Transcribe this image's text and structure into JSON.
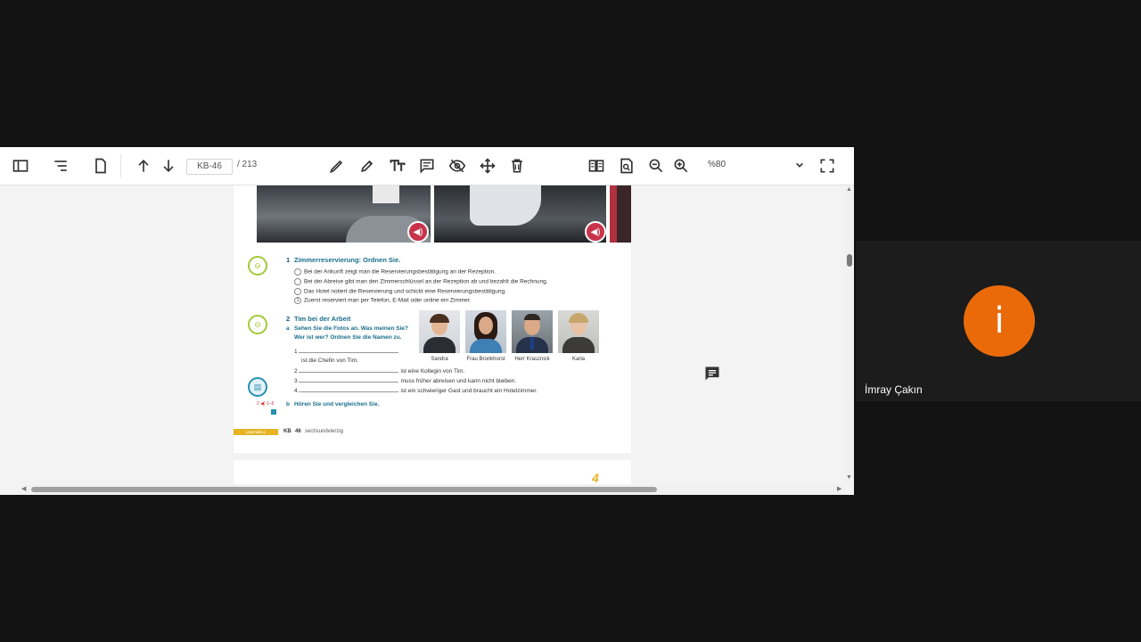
{
  "toolbar": {
    "page_current": "KB-46",
    "page_total": "/ 213",
    "zoom": "%80"
  },
  "document": {
    "ex1": {
      "number": "1",
      "title": "Zimmerreservierung: Ordnen Sie.",
      "items": [
        {
          "marker": "",
          "text": "Bei der Ankunft zeigt man die Reservierungsbestätigung an der Rezeption."
        },
        {
          "marker": "",
          "text": "Bei der Abreise gibt man den Zimmerschlüssel an der Rezeption ab und bezahlt die Rechnung."
        },
        {
          "marker": "",
          "text": "Das Hotel notiert die Reservierung und schickt eine Reservierungsbestätigung."
        },
        {
          "marker": "1",
          "text": "Zuerst reserviert man per Telefon, E-Mail oder online ein Zimmer."
        }
      ]
    },
    "ex2": {
      "number": "2",
      "title": "Tim bei der Arbeit",
      "a_label": "a",
      "a_line1": "Sehen Sie die Fotos an. Was meinen Sie?",
      "a_line2": "Wer ist wer? Ordnen Sie die Namen zu.",
      "names": [
        "Sandra",
        "Frau Bronkhorst",
        "Herr Krasznick",
        "Karla"
      ],
      "lines": [
        {
          "n": "1",
          "text": ""
        },
        {
          "n": "",
          "text": "ist die Chefin von Tim."
        },
        {
          "n": "2",
          "text": "ist eine Kollegin von Tim."
        },
        {
          "n": "3",
          "text": "muss früher abreisen und kann nicht bleiben."
        },
        {
          "n": "4",
          "text": "ist ein schwieriger Gast und braucht ein Hotelzimmer."
        }
      ],
      "track": "2 ◀) 1–6",
      "b_label": "b",
      "b_text": "Hören Sie und vergleichen Sie."
    },
    "footer": {
      "lektion": "LEKTION 4",
      "kb": "KB",
      "page": "46",
      "word": "sechsundvierzig"
    },
    "next_page_mark": "4"
  },
  "participant": {
    "initial": "i",
    "name": "İmray Çakın",
    "avatar_color": "#ea6a0a"
  }
}
